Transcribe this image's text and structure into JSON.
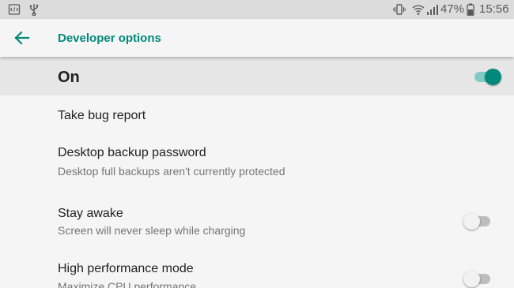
{
  "status_bar": {
    "left_icons": [
      "debug-icon",
      "usb-icon"
    ],
    "right_icons": [
      "vibrate-icon",
      "wifi-icon",
      "signal-icon",
      "battery-icon"
    ],
    "battery": "47%",
    "time": "15:56"
  },
  "app_bar": {
    "back_icon": "arrow-back-icon",
    "title": "Developer options"
  },
  "master_switch": {
    "label": "On",
    "state": "on"
  },
  "settings": {
    "items": [
      {
        "title": "Take bug report"
      },
      {
        "title": "Desktop backup password",
        "summary": "Desktop full backups aren't currently protected"
      },
      {
        "title": "Stay awake",
        "summary": "Screen will never sleep while charging",
        "toggle": "off"
      },
      {
        "title": "High performance mode",
        "summary": "Maximize CPU performance",
        "toggle": "off"
      }
    ]
  },
  "colors": {
    "accent": "#00897b",
    "accent_light": "#80cbc4",
    "background": "#f5f5f5",
    "status_bar": "#dcdcdc",
    "master_row": "#e6e6e6"
  }
}
